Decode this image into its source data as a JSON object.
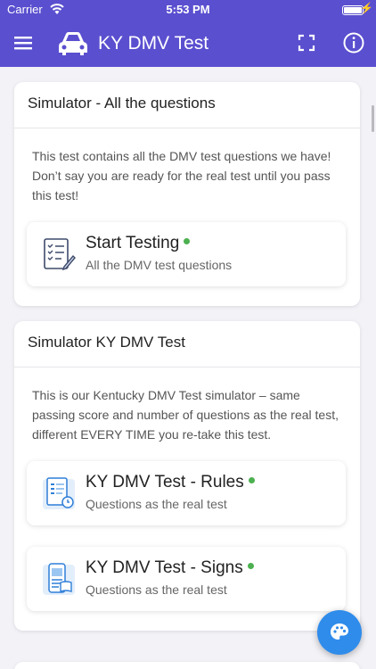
{
  "status_bar": {
    "carrier": "Carrier",
    "time": "5:53 PM",
    "battery_level": 1.0
  },
  "app_bar": {
    "title": "KY DMV Test",
    "menu_icon": "hamburger-menu-icon",
    "car_icon": "car-icon",
    "fullscreen_icon": "fullscreen-icon",
    "info_icon": "info-icon"
  },
  "cards": [
    {
      "header": "Simulator - All the questions",
      "description": "This test contains all the DMV test questions we have! Don’t say you are ready for the real test until you pass this test!",
      "items": [
        {
          "title": "Start Testing",
          "subtitle": "All the DMV test questions",
          "icon": "checklist-icon"
        }
      ]
    },
    {
      "header": "Simulator KY DMV Test",
      "description": "This is our Kentucky DMV Test simulator – same passing score and number of questions as the real test, different EVERY TIME you re-take this test.",
      "items": [
        {
          "title": "KY DMV Test - Rules",
          "subtitle": "Questions as the real test",
          "icon": "rules-document-icon"
        },
        {
          "title": "KY DMV Test - Signs",
          "subtitle": "Questions as the real test",
          "icon": "signs-book-icon"
        }
      ]
    }
  ],
  "fab": {
    "icon": "palette-icon"
  },
  "colors": {
    "primary": "#5a4fcf",
    "accent": "#2f8ceb",
    "status_dot": "#4cb050"
  }
}
